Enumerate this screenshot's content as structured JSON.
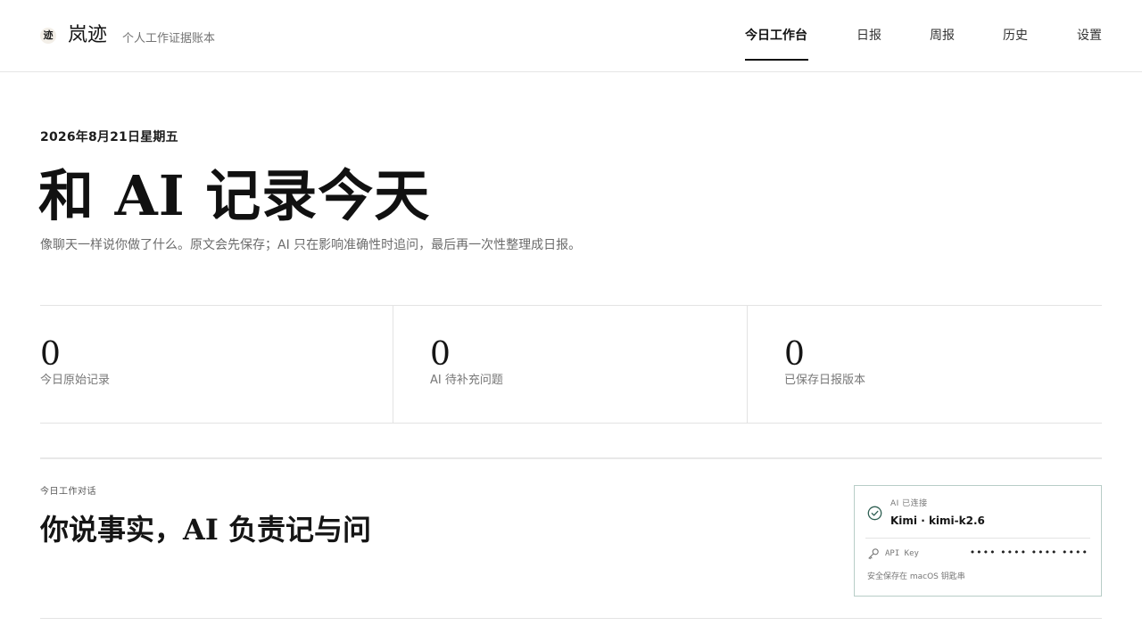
{
  "header": {
    "logo_glyph": "迹",
    "brand": "岚迹",
    "tagline": "个人工作证据账本"
  },
  "nav": {
    "items": [
      {
        "label": "今日工作台",
        "active": true
      },
      {
        "label": "日报",
        "active": false
      },
      {
        "label": "周报",
        "active": false
      },
      {
        "label": "历史",
        "active": false
      },
      {
        "label": "设置",
        "active": false
      }
    ]
  },
  "hero": {
    "date": "2026年8月21日星期五",
    "title": "和 AI 记录今天",
    "subtitle": "像聊天一样说你做了什么。原文会先保存；AI 只在影响准确性时追问，最后再一次性整理成日报。"
  },
  "stats": [
    {
      "value": "0",
      "label": "今日原始记录"
    },
    {
      "value": "0",
      "label": "AI 待补充问题"
    },
    {
      "value": "0",
      "label": "已保存日报版本"
    }
  ],
  "section": {
    "eyebrow": "今日工作对话",
    "title": "你说事实，AI 负责记与问"
  },
  "ai_card": {
    "status": "AI 已连接",
    "model": "Kimi · kimi-k2.6",
    "api_label": "API Key",
    "api_mask": "•••• •••• •••• ••••",
    "keychain_note": "安全保存在 macOS 钥匙串",
    "status_icon": "check-circle-icon",
    "key_icon": "key-icon",
    "accent_color": "#2f5f52",
    "border_color": "#b8cdc7"
  },
  "colors": {
    "text_primary": "#111111",
    "text_muted": "#777777",
    "divider": "#e3e3e3"
  }
}
